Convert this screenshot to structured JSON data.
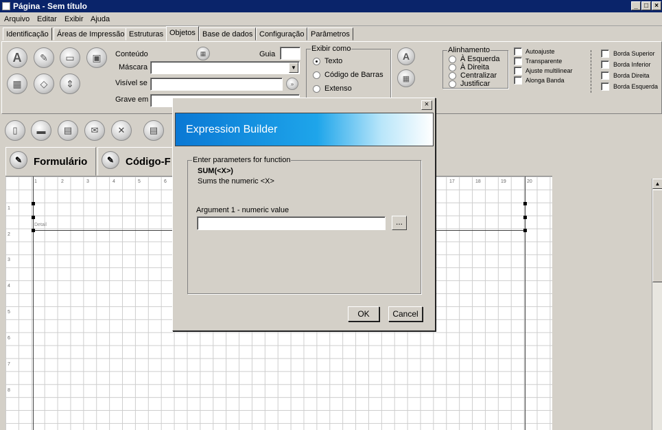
{
  "window": {
    "title": "Página - Sem título",
    "controls": [
      "_",
      "□",
      "×"
    ]
  },
  "menu": [
    "Arquivo",
    "Editar",
    "Exibir",
    "Ajuda"
  ],
  "tabs": [
    "Identificação",
    "Áreas de Impressão",
    "Estruturas",
    "Objetos",
    "Base de dados",
    "Configuração",
    "Parâmetros"
  ],
  "active_tab": "Objetos",
  "object_panel": {
    "conteudo_label": "Conteúdo",
    "guia_label": "Guia",
    "mascara_label": "Máscara",
    "visivel_label": "Visível se",
    "grave_label": "Grave em",
    "exibir_como": {
      "title": "Exibir como",
      "options": [
        "Texto",
        "Código de Barras",
        "Extenso"
      ],
      "selected": "Texto"
    },
    "alinhamento": {
      "title": "Alinhamento",
      "options": [
        "À Esquerda",
        "À Direita",
        "Centralizar",
        "Justificar"
      ]
    },
    "checks": [
      "Autoajuste",
      "Transparente",
      "Ajuste multilinear",
      "Alonga Banda"
    ],
    "bordas": [
      "Borda Superior",
      "Borda Inferior",
      "Borda Direita",
      "Borda Esquerda"
    ]
  },
  "view_tabs": [
    "Formulário",
    "Código-F"
  ],
  "canvas": {
    "top_ruler": [
      "1",
      "2",
      "3",
      "4",
      "5",
      "6",
      "17",
      "18",
      "19",
      "20"
    ],
    "left_ruler": [
      "1",
      "2",
      "3",
      "4",
      "5",
      "6",
      "7",
      "8"
    ],
    "band_label": "Detail"
  },
  "dialog": {
    "title": "Expression Builder",
    "group_title": "Enter parameters for function",
    "function_name": "SUM(<X>)",
    "function_desc": "Sums the numeric <X>",
    "arg_label": "Argument 1 - numeric value",
    "arg_value": "",
    "browse_label": "...",
    "ok_label": "OK",
    "cancel_label": "Cancel",
    "close_label": "×"
  }
}
